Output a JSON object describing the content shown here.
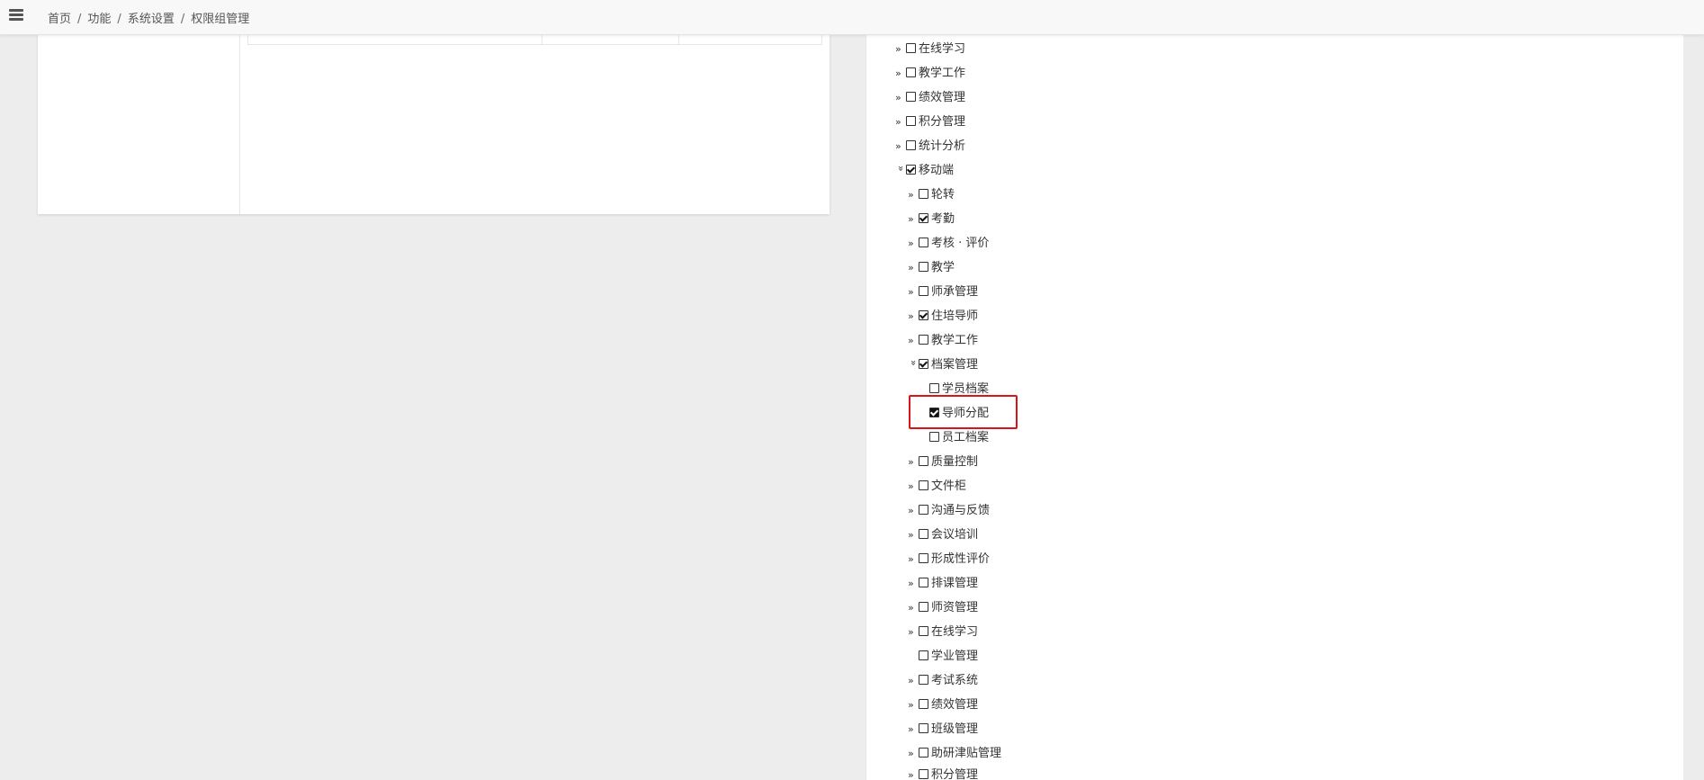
{
  "breadcrumb": {
    "home": "首页",
    "level1": "功能",
    "level2": "系统设置",
    "current": "权限组管理",
    "separator": "/"
  },
  "tree": {
    "top_items": [
      {
        "label": "在线学习",
        "checked": false
      },
      {
        "label": "教学工作",
        "checked": false
      },
      {
        "label": "绩效管理",
        "checked": false
      },
      {
        "label": "积分管理",
        "checked": false
      },
      {
        "label": "统计分析",
        "checked": false
      }
    ],
    "mobile": {
      "label": "移动端",
      "checked": true,
      "children": [
        {
          "label": "轮转",
          "checked": false
        },
        {
          "label": "考勤",
          "checked": true
        },
        {
          "label": "考核 · 评价",
          "checked": false
        },
        {
          "label": "教学",
          "checked": false
        },
        {
          "label": "师承管理",
          "checked": false
        },
        {
          "label": "住培导师",
          "checked": true
        },
        {
          "label": "教学工作",
          "checked": false
        }
      ],
      "archive": {
        "label": "档案管理",
        "checked": true,
        "children": [
          {
            "label": "学员档案",
            "checked": false
          },
          {
            "label": "导师分配",
            "checked": true
          },
          {
            "label": "员工档案",
            "checked": false
          }
        ]
      },
      "more_children": [
        {
          "label": "质量控制",
          "checked": false
        },
        {
          "label": "文件柜",
          "checked": false
        },
        {
          "label": "沟通与反馈",
          "checked": false
        },
        {
          "label": "会议培训",
          "checked": false
        },
        {
          "label": "形成性评价",
          "checked": false
        },
        {
          "label": "排课管理",
          "checked": false
        },
        {
          "label": "师资管理",
          "checked": false
        },
        {
          "label": "在线学习",
          "checked": false
        },
        {
          "label": "学业管理",
          "checked": false
        },
        {
          "label": "考试系统",
          "checked": false
        },
        {
          "label": "绩效管理",
          "checked": false
        },
        {
          "label": "班级管理",
          "checked": false
        },
        {
          "label": "助研津贴管理",
          "checked": false
        },
        {
          "label": "积分管理",
          "checked": false
        }
      ]
    }
  },
  "icons": {
    "expand": "»",
    "collapse": "»"
  }
}
